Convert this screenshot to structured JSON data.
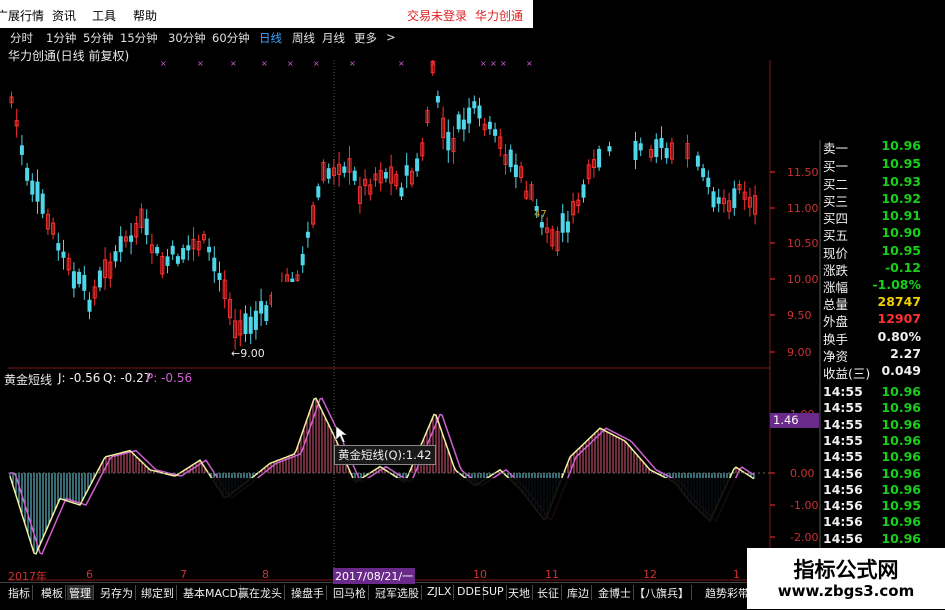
{
  "menubar": {
    "items": [
      "行情",
      "资讯",
      "工具",
      "帮助"
    ],
    "first_item_partial": "广展行情",
    "login": "交易未登录",
    "stock_name": "华力创通"
  },
  "periods": {
    "items": [
      "分时",
      "1分钟",
      "5分钟",
      "15分钟",
      "30分钟",
      "60分钟",
      "日线",
      "周线",
      "月线",
      "更多"
    ],
    "active": "日线",
    "arrow": ">"
  },
  "chart": {
    "title": "华力创通(日线 前复权)",
    "low_marker": "9.00",
    "price_axis": [
      "11.50",
      "11.00",
      "10.50",
      "10.00",
      "9.50",
      "9.00"
    ],
    "badge_value": "47",
    "colors": {
      "up": "#ff3030",
      "down": "#4fd6e8",
      "grid": "#7a1a1a"
    }
  },
  "indicator": {
    "name": "黄金短线",
    "j_label": "J: -0.56",
    "q_label": "Q: -0.27",
    "p_label": "P: -0.56",
    "tooltip": "黄金短线(Q):1.42",
    "cursor_value": "1.46",
    "axis": [
      "1.00",
      "0.00",
      "-1.00",
      "-2.00"
    ]
  },
  "date_axis": {
    "labels": [
      "2017年",
      "6",
      "7",
      "8",
      "9",
      "10",
      "11",
      "12",
      "1"
    ],
    "cursor_date": "2017/08/21/一"
  },
  "quote": {
    "rows": [
      {
        "label": "卖一",
        "value": "10.96",
        "color": "#17d117"
      },
      {
        "label": "买一",
        "value": "10.95",
        "color": "#17d117"
      },
      {
        "label": "买二",
        "value": "10.93",
        "color": "#17d117"
      },
      {
        "label": "买三",
        "value": "10.92",
        "color": "#17d117"
      },
      {
        "label": "买四",
        "value": "10.91",
        "color": "#17d117"
      },
      {
        "label": "买五",
        "value": "10.90",
        "color": "#17d117"
      },
      {
        "label": "现价",
        "value": "10.95",
        "color": "#17d117"
      },
      {
        "label": "涨跌",
        "value": "-0.12",
        "color": "#17d117"
      },
      {
        "label": "涨幅",
        "value": "-1.08%",
        "color": "#17d117"
      },
      {
        "label": "总量",
        "value": "28747",
        "color": "#f0d000"
      },
      {
        "label": "外盘",
        "value": "12907",
        "color": "#ff3030"
      },
      {
        "label": "换手",
        "value": "0.80%",
        "color": "#f0f0f0"
      },
      {
        "label": "净资",
        "value": "2.27",
        "color": "#f0f0f0"
      },
      {
        "label": "收益(三)",
        "value": "0.049",
        "color": "#f0f0f0"
      }
    ],
    "trades": [
      {
        "time": "14:55",
        "price": "10.96"
      },
      {
        "time": "14:55",
        "price": "10.96"
      },
      {
        "time": "14:55",
        "price": "10.96"
      },
      {
        "time": "14:55",
        "price": "10.96"
      },
      {
        "time": "14:55",
        "price": "10.96"
      },
      {
        "time": "14:56",
        "price": "10.96"
      },
      {
        "time": "14:56",
        "price": "10.96"
      },
      {
        "time": "14:56",
        "price": "10.95"
      },
      {
        "time": "14:56",
        "price": "10.96"
      },
      {
        "time": "14:56",
        "price": "10.96"
      },
      {
        "time": "14:56",
        "price": "10.96"
      }
    ]
  },
  "toolbar": {
    "items": [
      "指标",
      "模板",
      "管理",
      "另存为",
      "绑定到",
      "基本MACD",
      "赢在龙头",
      "操盘手",
      "回马枪",
      "冠军选股",
      "ZJLX",
      "DDE",
      "SUP",
      "天地",
      "长征",
      "库边",
      "金博士",
      "【八旗兵】",
      "趋势彩带"
    ],
    "selected": "管理"
  },
  "watermark": {
    "title": "指标公式网",
    "url": "www.zbgs3.com"
  }
}
